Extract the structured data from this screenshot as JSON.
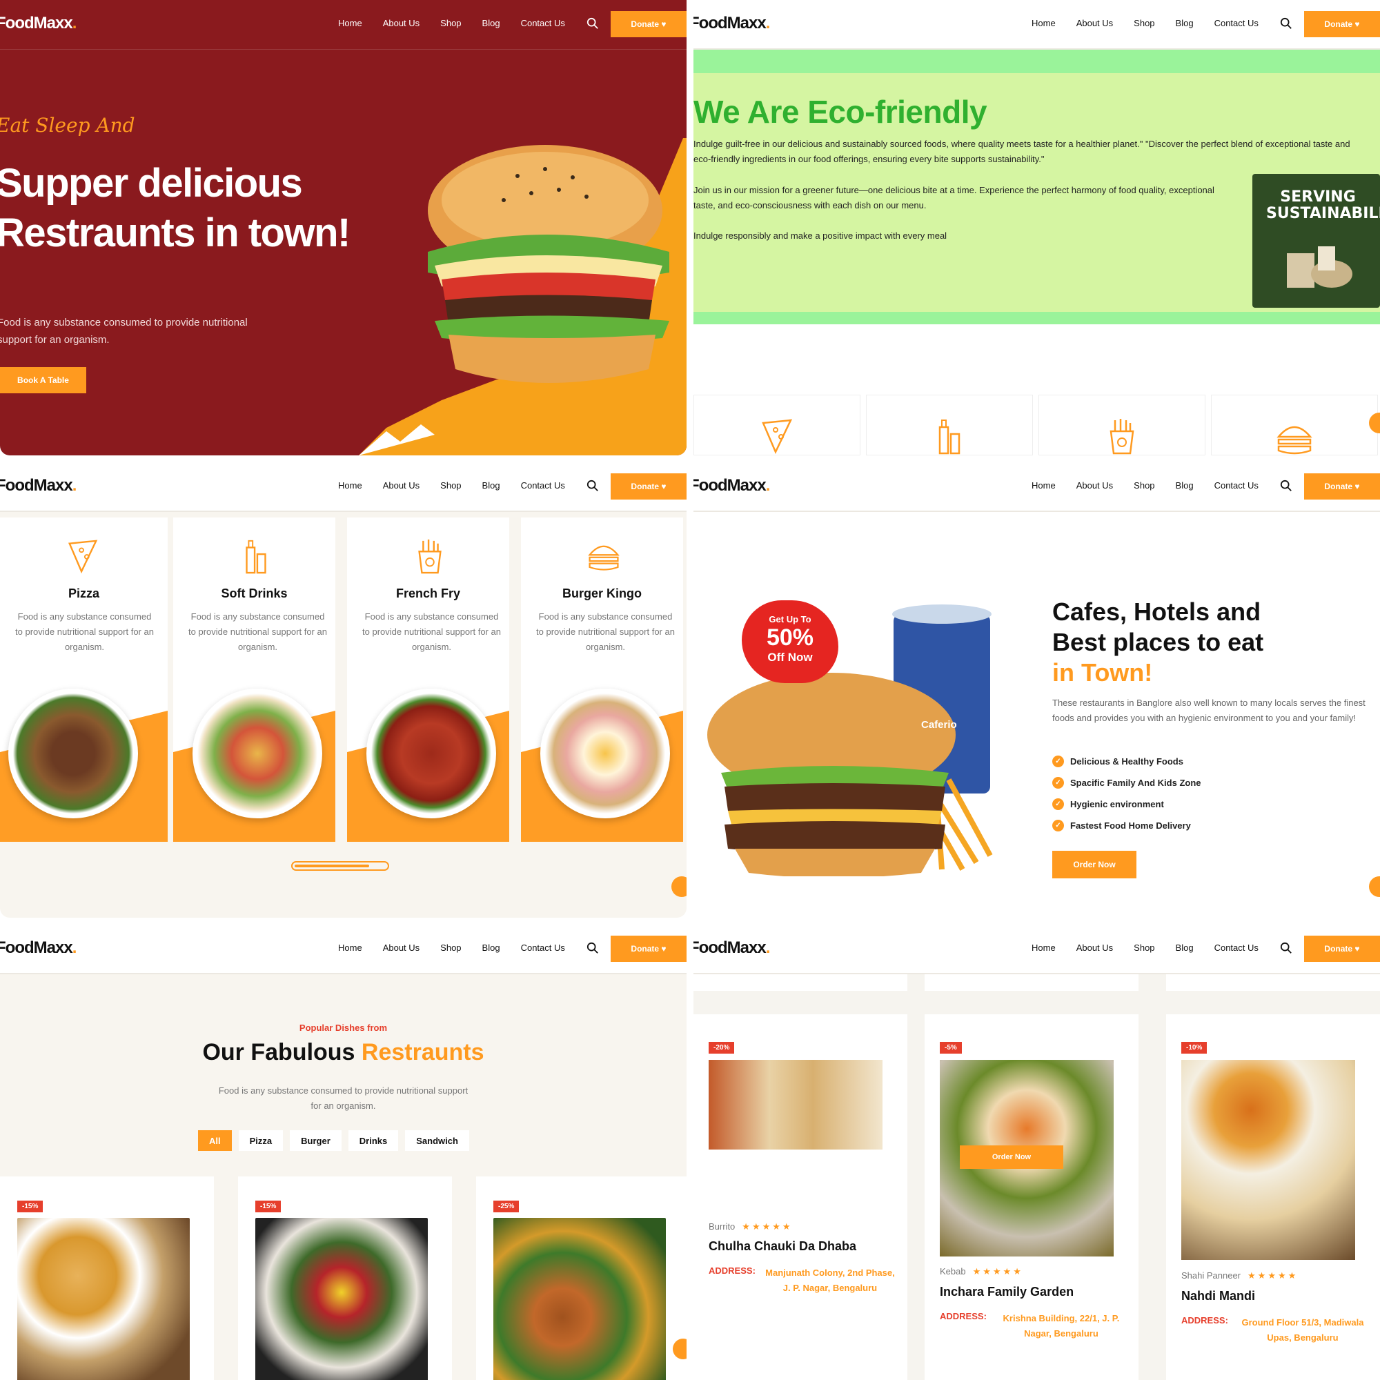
{
  "brand": {
    "logo": "FoodMaxx",
    "accent": "#ff9a1f",
    "red": "#e63f2c"
  },
  "nav": {
    "items": [
      "Home",
      "About Us",
      "Shop",
      "Blog",
      "Contact Us"
    ],
    "donate": "Donate ♥",
    "search_icon": "search-icon"
  },
  "hero": {
    "tagline": "Eat Sleep And",
    "headline": "Supper delicious Restraunts in town!",
    "description": "Food is any substance consumed to provide nutritional support for an organism.",
    "button": "Book A Table"
  },
  "eco": {
    "title": "We Are Eco-friendly",
    "p1": "Indulge guilt-free in our delicious and sustainably sourced foods, where quality meets taste for a healthier planet.\" \"Discover the perfect blend of exceptional taste and",
    "p1b": "eco-friendly ingredients in our food offerings, ensuring every bite supports sustainability.\"",
    "p2": "Join us in our mission for a greener future—one delicious bite at a time. Experience the perfect harmony of food quality, exceptional",
    "p2b": "taste, and eco-consciousness with each dish on our menu.",
    "p3": "Indulge responsibly and make a positive impact with every meal",
    "image_text": "SERVING SUSTAINABILITY"
  },
  "categories": [
    {
      "title": "Pizza",
      "desc": "Food is any substance consumed to provide nutritional support for an organism.",
      "icon": "pizza-icon"
    },
    {
      "title": "Soft Drinks",
      "desc": "Food is any substance consumed to provide nutritional support for an organism.",
      "icon": "drinks-icon"
    },
    {
      "title": "French Fry",
      "desc": "Food is any substance consumed to provide nutritional support for an organism.",
      "icon": "fries-icon"
    },
    {
      "title": "Burger Kingo",
      "desc": "Food is any substance consumed to provide nutritional support for an organism.",
      "icon": "burger-icon"
    }
  ],
  "promo": {
    "badge_top": "Get Up To",
    "badge_pct": "50%",
    "badge_bottom": "Off Now",
    "cup_brand": "Caferio",
    "headline_1": "Cafes, Hotels and",
    "headline_2": "Best places to eat",
    "headline_3": "in Town!",
    "description": "These restaurants in Banglore also well known to many locals serves the finest foods and provides you with an hygienic environment to you and your family!",
    "checks": [
      "Delicious & Healthy Foods",
      "Spacific Family And Kids Zone",
      "Hygienic environment",
      "Fastest Food Home Delivery"
    ],
    "button": "Order Now"
  },
  "popular": {
    "subtitle": "Popular Dishes from",
    "title_a": "Our Fabulous",
    "title_b": "Restraunts",
    "description": "Food is any substance consumed to provide nutritional support for an organism.",
    "filters": [
      "All",
      "Pizza",
      "Burger",
      "Drinks",
      "Sandwich"
    ],
    "active_filter": "All",
    "discounts": [
      "-15%",
      "-15%",
      "-25%"
    ]
  },
  "restaurants": [
    {
      "discount": "-20%",
      "category": "Burrito",
      "stars": "★★★★★",
      "name": "Chulha Chauki Da Dhaba",
      "address_label": "ADDRESS:",
      "address": "Manjunath Colony, 2nd Phase, J. P. Nagar, Bengaluru"
    },
    {
      "discount": "-5%",
      "category": "Kebab",
      "stars": "★★★★★",
      "name": "Inchara Family Garden",
      "address_label": "ADDRESS:",
      "address": "Krishna Building, 22/1, J. P. Nagar, Bengaluru",
      "overlay_button": "Order Now"
    },
    {
      "discount": "-10%",
      "category": "Shahi Panneer",
      "stars": "★★★★★",
      "name": "Nahdi Mandi",
      "address_label": "ADDRESS:",
      "address": "Ground Floor 51/3, Madiwala Upas, Bengaluru"
    }
  ]
}
